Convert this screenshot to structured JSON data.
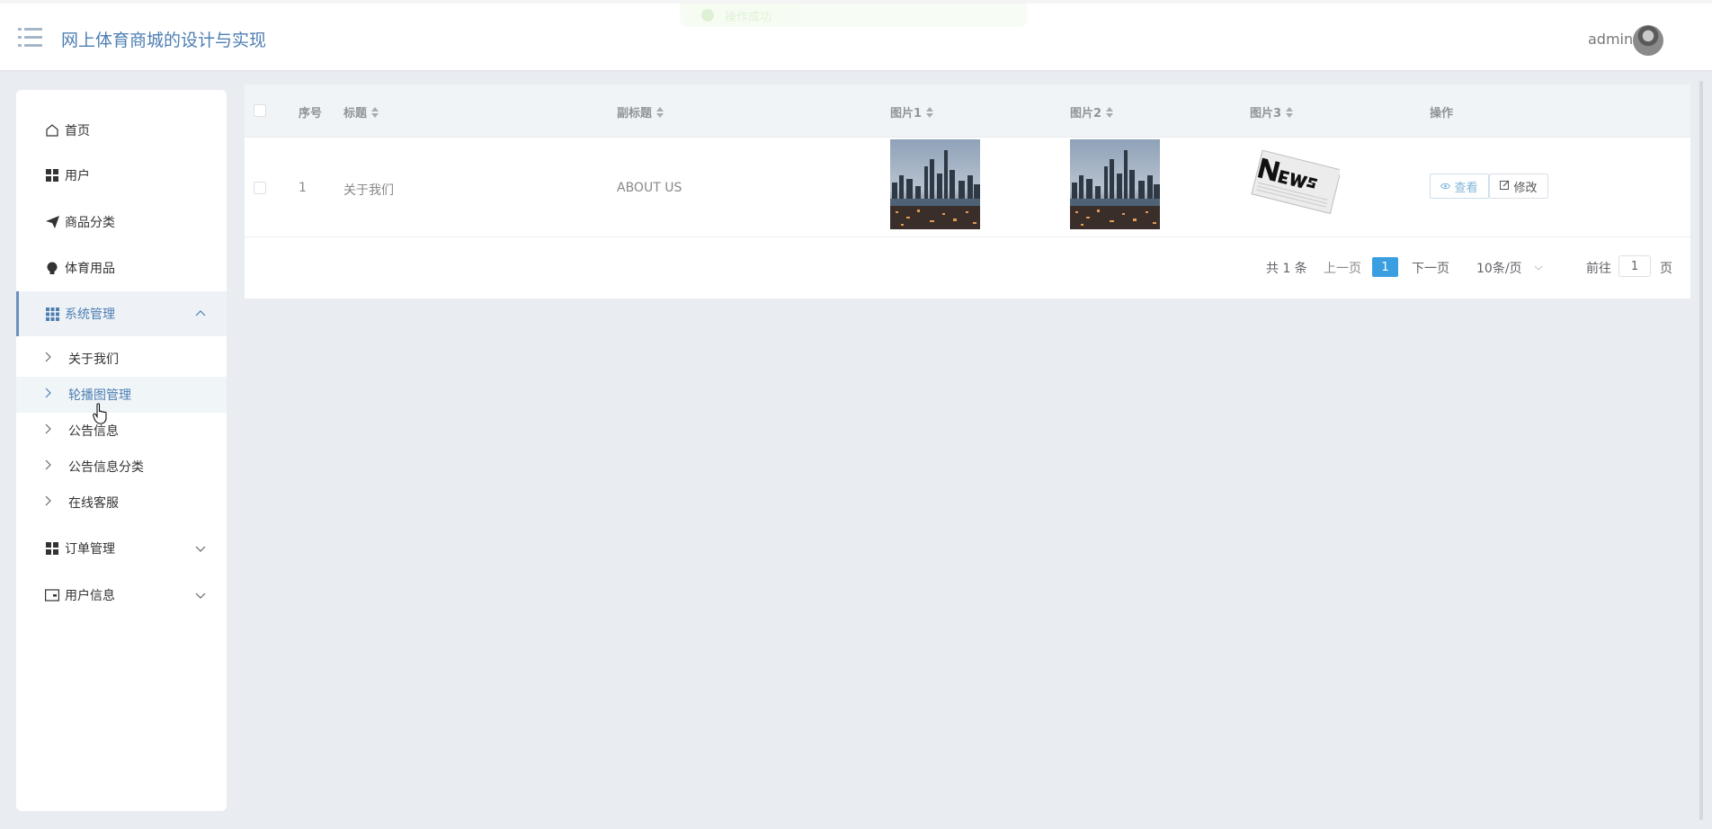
{
  "header": {
    "title": "网上体育商城的设计与实现",
    "user": "admin",
    "toast": "操作成功"
  },
  "sidebar": {
    "items": [
      {
        "label": "首页",
        "icon": "home-icon"
      },
      {
        "label": "用户",
        "icon": "grid-icon"
      },
      {
        "label": "商品分类",
        "icon": "paper-plane-icon"
      },
      {
        "label": "体育用品",
        "icon": "lightbulb-icon"
      },
      {
        "label": "系统管理",
        "icon": "apps-icon"
      },
      {
        "label": "订单管理",
        "icon": "grid-icon"
      },
      {
        "label": "用户信息",
        "icon": "wallet-icon"
      }
    ],
    "submenu": [
      {
        "label": "关于我们"
      },
      {
        "label": "轮播图管理"
      },
      {
        "label": "公告信息"
      },
      {
        "label": "公告信息分类"
      },
      {
        "label": "在线客服"
      }
    ]
  },
  "table": {
    "columns": [
      "序号",
      "标题",
      "副标题",
      "图片1",
      "图片2",
      "图片3",
      "操作"
    ],
    "rows": [
      {
        "index": "1",
        "title": "关于我们",
        "subtitle": "ABOUT US"
      }
    ],
    "actions": {
      "view": "查看",
      "edit": "修改"
    }
  },
  "pagination": {
    "total": "共 1 条",
    "prev": "上一页",
    "current": "1",
    "next": "下一页",
    "page_size": "10条/页",
    "goto_prefix": "前往",
    "goto_value": "1",
    "goto_suffix": "页"
  },
  "colors": {
    "accent": "#4e7fb3",
    "page_active": "#3a9fe0",
    "background": "#e9ecf1"
  }
}
